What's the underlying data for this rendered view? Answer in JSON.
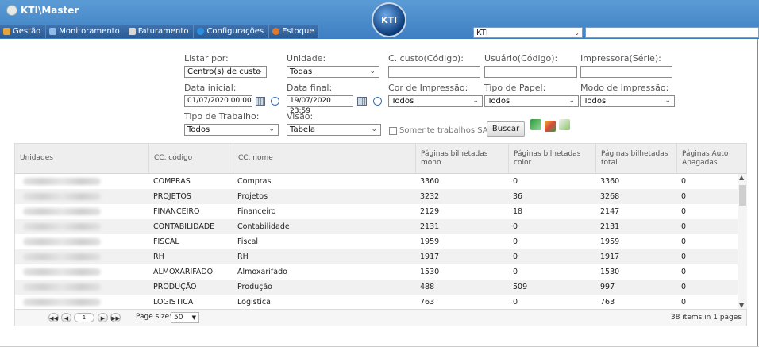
{
  "app": {
    "title": "KTI\\Master",
    "logo_text": "KTI"
  },
  "menu": [
    {
      "label": "Gestão",
      "icon": "gestao-icon",
      "color": "#e8a33a"
    },
    {
      "label": "Monitoramento",
      "icon": "monitor-icon",
      "color": "#8fb9e8"
    },
    {
      "label": "Faturamento",
      "icon": "chart-icon",
      "color": "#d7d7d7"
    },
    {
      "label": "Configurações",
      "icon": "gear-icon",
      "color": "#2a8fe0"
    },
    {
      "label": "Estoque",
      "icon": "box-icon",
      "color": "#e07a2a"
    }
  ],
  "company": {
    "selected": "KTI",
    "search_value": ""
  },
  "filters": {
    "listar_por": {
      "label": "Listar por:",
      "value": "Centro(s) de custo"
    },
    "unidade": {
      "label": "Unidade:",
      "value": "Todas"
    },
    "ccusto": {
      "label": "C. custo(Código):",
      "value": ""
    },
    "usuario": {
      "label": "Usuário(Código):",
      "value": ""
    },
    "impressora": {
      "label": "Impressora(Série):",
      "value": ""
    },
    "data_inicial": {
      "label": "Data inicial:",
      "value": "01/07/2020 00:00"
    },
    "data_final": {
      "label": "Data final:",
      "value": "19/07/2020 23:59"
    },
    "cor": {
      "label": "Cor de Impressão:",
      "value": "Todos"
    },
    "papel": {
      "label": "Tipo de Papel:",
      "value": "Todos"
    },
    "modo": {
      "label": "Modo de Impressão:",
      "value": "Todos"
    },
    "tipo_trabalho": {
      "label": "Tipo de Trabalho:",
      "value": "Todos"
    },
    "visao": {
      "label": "Visão:",
      "value": "Tabela"
    },
    "sap_label": "Somente trabalhos SAP",
    "buscar_label": "Buscar"
  },
  "table": {
    "columns": [
      "Unidades",
      "CC. código",
      "CC. nome",
      "Páginas bilhetadas mono",
      "Páginas bilhetadas color",
      "Páginas bilhetadas total",
      "Páginas Auto Apagadas"
    ],
    "rows": [
      [
        "COMPRAS",
        "Compras",
        "3360",
        "0",
        "3360",
        "0"
      ],
      [
        "PROJETOS",
        "Projetos",
        "3232",
        "36",
        "3268",
        "0"
      ],
      [
        "FINANCEIRO",
        "Financeiro",
        "2129",
        "18",
        "2147",
        "0"
      ],
      [
        "CONTABILIDADE",
        "Contabilidade",
        "2131",
        "0",
        "2131",
        "0"
      ],
      [
        "FISCAL",
        "Fiscal",
        "1959",
        "0",
        "1959",
        "0"
      ],
      [
        "RH",
        "RH",
        "1917",
        "0",
        "1917",
        "0"
      ],
      [
        "ALMOXARIFADO",
        "Almoxarifado",
        "1530",
        "0",
        "1530",
        "0"
      ],
      [
        "PRODUÇÃO",
        "Produção",
        "488",
        "509",
        "997",
        "0"
      ],
      [
        "LOGISTICA",
        "Logistica",
        "763",
        "0",
        "763",
        "0"
      ]
    ]
  },
  "pager": {
    "page": "1",
    "size_label": "Page size:",
    "size_value": "50",
    "info": "38 items in 1 pages"
  }
}
